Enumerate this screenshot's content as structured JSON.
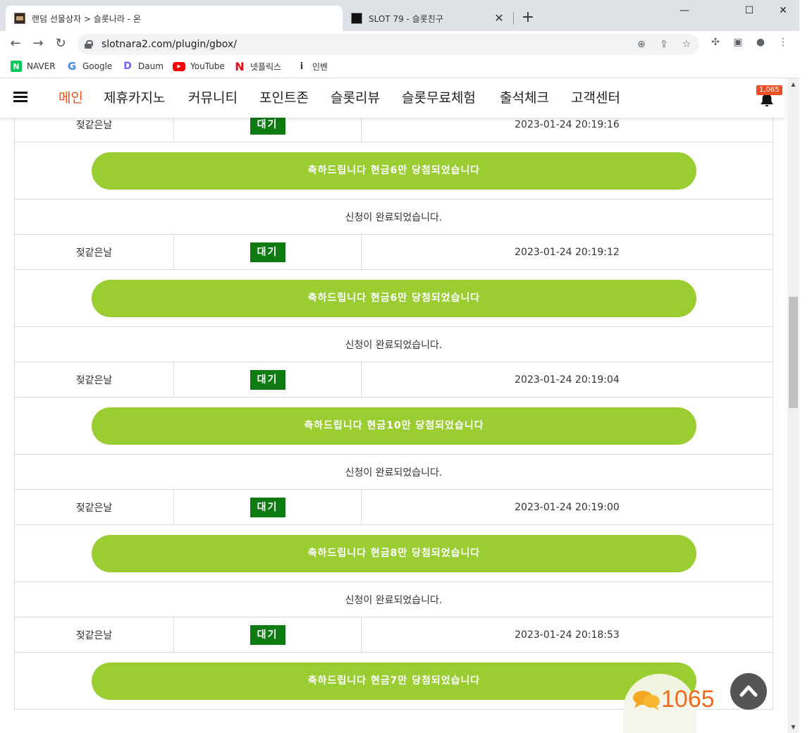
{
  "browser": {
    "tabs": [
      {
        "title": "랜덤 선물상자 > 슬롯나라 - 온",
        "active": true
      },
      {
        "title": "SLOT 79 - 슬롯친구",
        "active": false
      }
    ],
    "close_glyph": "✕",
    "new_tab_glyph": "+",
    "window_controls": {
      "minimize": "—",
      "maximize": "☐",
      "close": "✕"
    },
    "url": "slotnara2.com/plugin/gbox/",
    "bookmarks": [
      {
        "label": "NAVER",
        "icon": "naver-icon",
        "glyph": "N"
      },
      {
        "label": "Google",
        "icon": "google-icon",
        "glyph": "G"
      },
      {
        "label": "Daum",
        "icon": "daum-icon",
        "glyph": "D"
      },
      {
        "label": "YouTube",
        "icon": "youtube-icon",
        "glyph": "▶"
      },
      {
        "label": "넷플릭스",
        "icon": "netflix-icon",
        "glyph": "N"
      },
      {
        "label": "인벤",
        "icon": "inven-icon",
        "glyph": "i"
      }
    ]
  },
  "site": {
    "menu": [
      {
        "label": "메인",
        "active": true
      },
      {
        "label": "제휴카지노",
        "active": false
      },
      {
        "label": "커뮤니티",
        "active": false
      },
      {
        "label": "포인트존",
        "active": false
      },
      {
        "label": "슬롯리뷰",
        "active": false
      },
      {
        "label": "슬롯무료체험",
        "active": false
      },
      {
        "label": "출석체크",
        "active": false
      },
      {
        "label": "고객센터",
        "active": false
      }
    ],
    "notification_count": "1,065",
    "accent_color": "#e8531c",
    "banner_color": "#9acd32",
    "status_color": "#0e7a12"
  },
  "entries": [
    {
      "user": "젖같은날",
      "status": "대기",
      "time": "2023-01-24 20:19:16",
      "prize": "축하드립니다 현금6만 당첨되었습니다",
      "message": "신청이 완료되었습니다."
    },
    {
      "user": "젖같은날",
      "status": "대기",
      "time": "2023-01-24 20:19:12",
      "prize": "축하드립니다 현금6만 당첨되었습니다",
      "message": "신청이 완료되었습니다."
    },
    {
      "user": "젖같은날",
      "status": "대기",
      "time": "2023-01-24 20:19:04",
      "prize": "축하드립니다 현금10만 당첨되었습니다",
      "message": "신청이 완료되었습니다."
    },
    {
      "user": "젖같은날",
      "status": "대기",
      "time": "2023-01-24 20:19:00",
      "prize": "축하드립니다 현금8만 당첨되었습니다",
      "message": "신청이 완료되었습니다."
    },
    {
      "user": "젖같은날",
      "status": "대기",
      "time": "2023-01-24 20:18:53",
      "prize": "축하드립니다 현금7만 당첨되었습니다",
      "message": ""
    }
  ],
  "chat_widget": {
    "count": "1065"
  },
  "scroll_top_icon": "chevron-up-icon"
}
